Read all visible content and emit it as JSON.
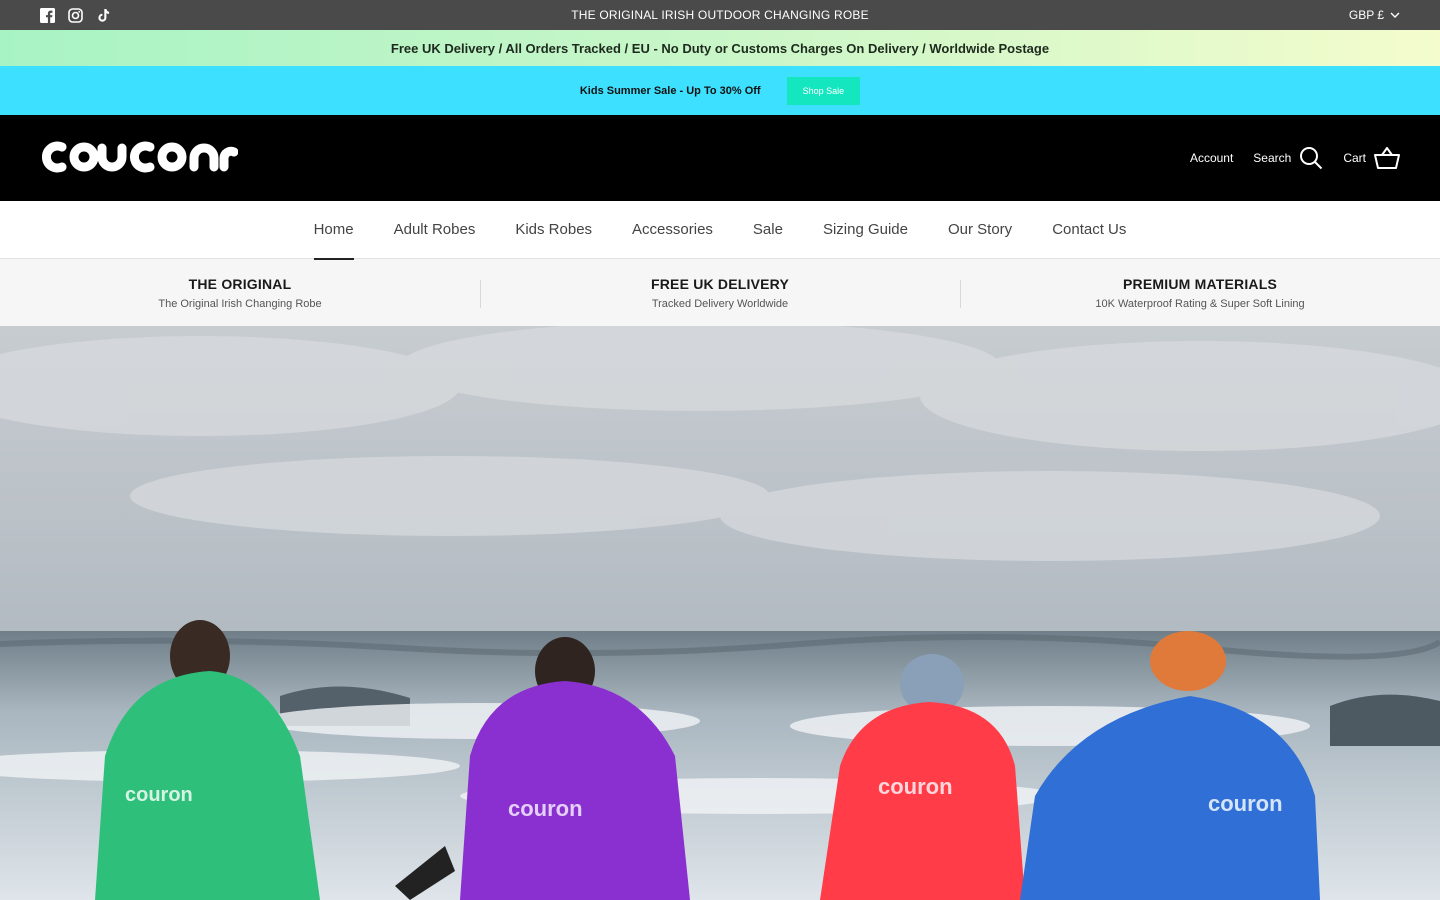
{
  "utility_bar": {
    "social_icons": [
      "facebook-icon",
      "instagram-icon",
      "tiktok-icon"
    ],
    "tagline": "THE ORIGINAL IRISH OUTDOOR CHANGING ROBE",
    "currency": "GBP £"
  },
  "delivery_bar": {
    "text": "Free UK Delivery / All Orders Tracked /  EU - No Duty or Customs Charges On Delivery / Worldwide Postage"
  },
  "sale_bar": {
    "text": "Kids Summer Sale - Up To 30% Off",
    "button_label": "Shop Sale"
  },
  "header": {
    "logo_text": "dryrobe-style brand logo",
    "account_label": "Account",
    "search_label": "Search",
    "cart_label": "Cart"
  },
  "nav": {
    "items": [
      {
        "label": "Home",
        "active": true
      },
      {
        "label": "Adult Robes"
      },
      {
        "label": "Kids Robes"
      },
      {
        "label": "Accessories"
      },
      {
        "label": "Sale"
      },
      {
        "label": "Sizing Guide"
      },
      {
        "label": "Our Story"
      },
      {
        "label": "Contact Us"
      }
    ]
  },
  "features": [
    {
      "title": "THE ORIGINAL",
      "subtitle": "The Original Irish Changing Robe"
    },
    {
      "title": "FREE UK DELIVERY",
      "subtitle": "Tracked Delivery Worldwide"
    },
    {
      "title": "PREMIUM MATERIALS",
      "subtitle": "10K Waterproof Rating & Super Soft Lining"
    }
  ],
  "colors": {
    "utility_bg": "#4a4a4a",
    "sale_bg": "#3ee0ff",
    "sale_button": "#14e6c0",
    "header_bg": "#000000",
    "robe_green": "#2ec07a",
    "robe_purple": "#8a2fd0",
    "robe_red": "#ff3c48",
    "robe_blue": "#2f6fd6"
  }
}
